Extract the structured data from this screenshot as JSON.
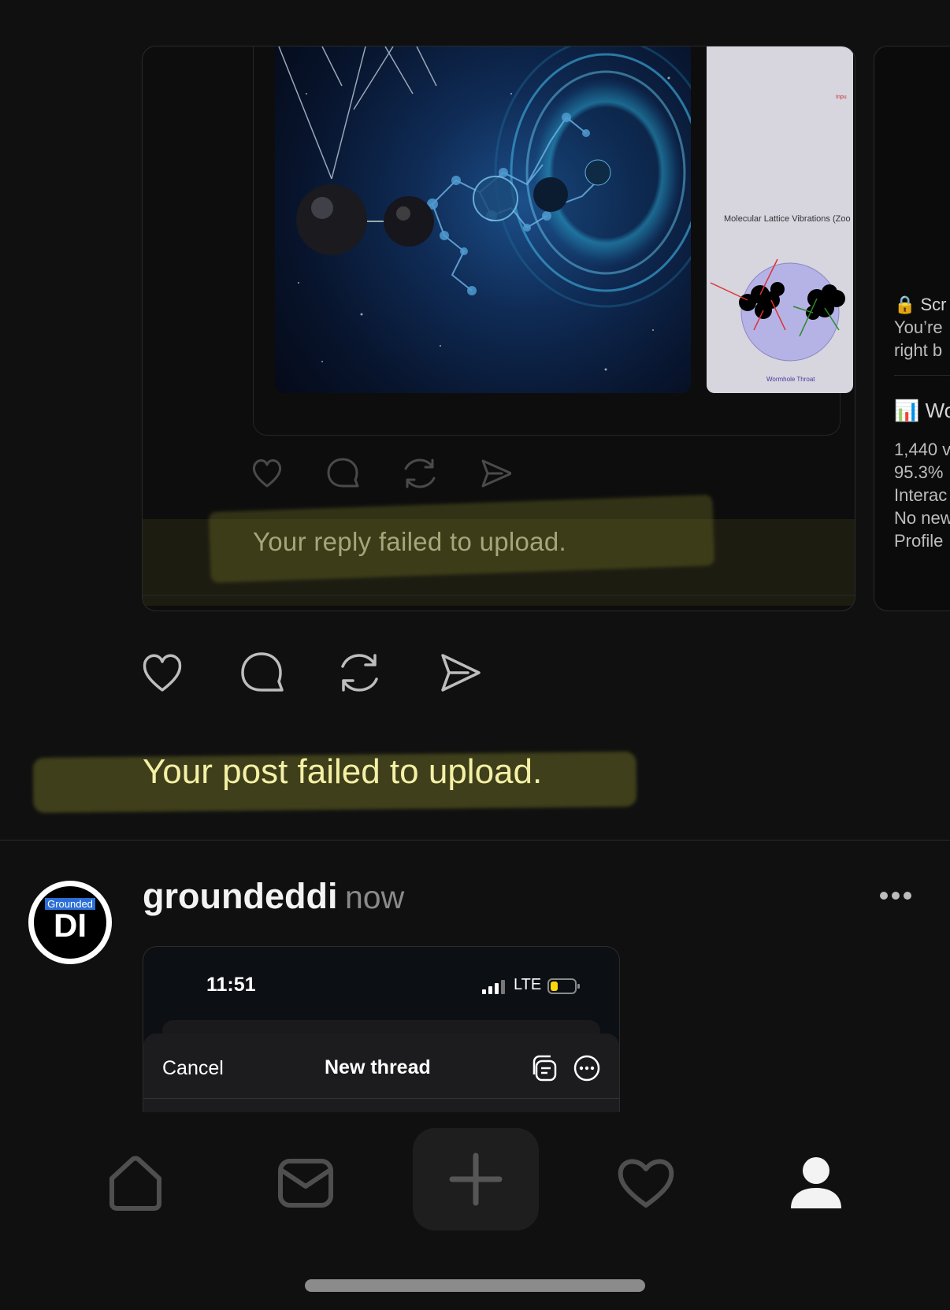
{
  "quoted_post": {
    "image_caption_title": "Molecular Lattice Vibrations (Zoo",
    "image_caption_bottom": "Wormhole Throat",
    "image_input_label": "Inpu",
    "failure_message": "Your reply failed to upload."
  },
  "right_card": {
    "line1": "🔒 Scr",
    "line2": "You’re",
    "line3": "right b",
    "line4": "📊 Wo",
    "line5": "1,440 v",
    "line6": "95.3%",
    "line7": "Interac",
    "line8": "No new",
    "line9": "Profile"
  },
  "post": {
    "failure_message": "Your post failed to upload."
  },
  "new_post": {
    "avatar_brand": "Grounded",
    "avatar_monogram": "DI",
    "username": "groundeddi",
    "timestamp": "now",
    "screenshot": {
      "time": "11:51",
      "network": "LTE",
      "cancel": "Cancel",
      "title": "New thread"
    }
  },
  "tabbar": {
    "items": [
      "home-icon",
      "inbox-icon",
      "plus-icon",
      "activity-heart-icon",
      "profile-icon"
    ]
  }
}
